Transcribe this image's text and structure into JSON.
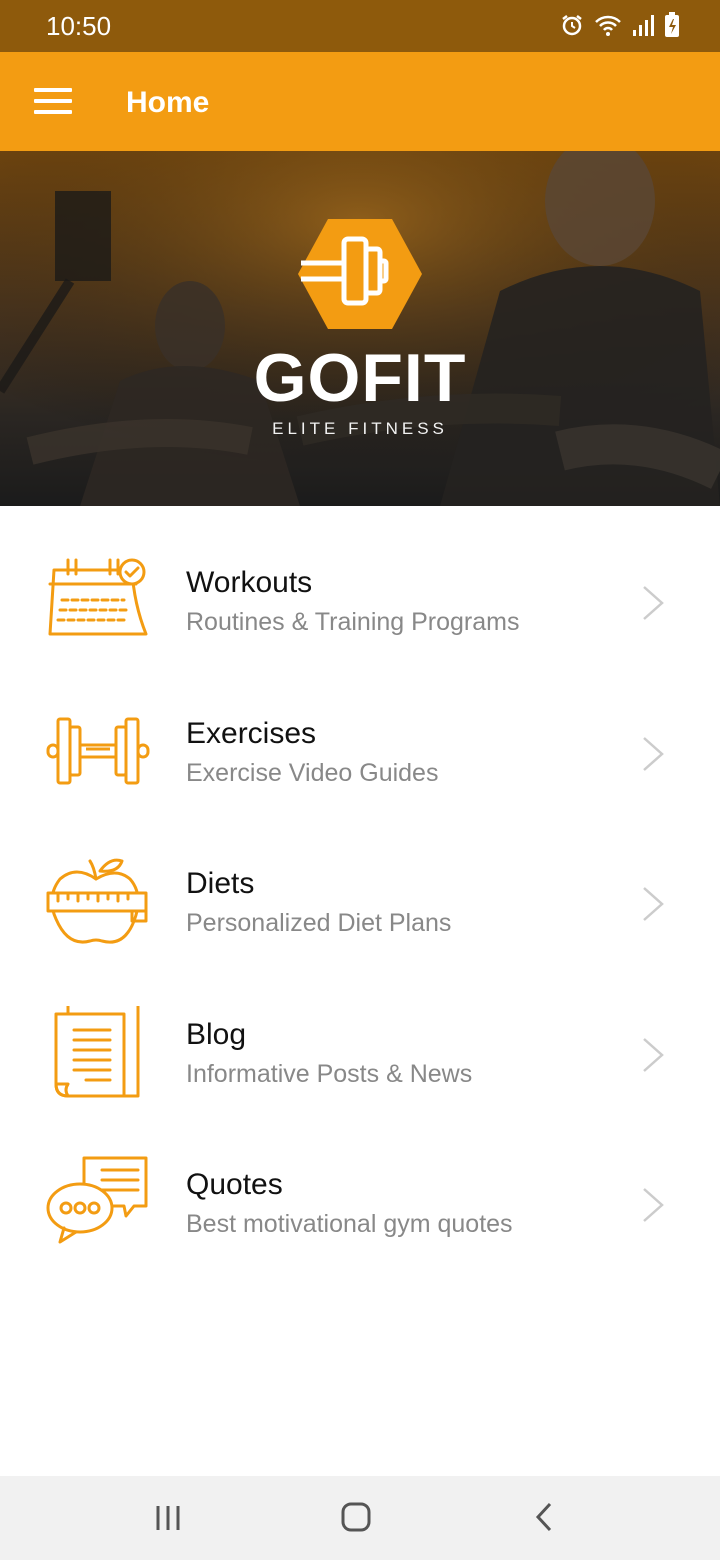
{
  "status_bar": {
    "time": "10:50",
    "icons": [
      "alarm-icon",
      "wifi-icon",
      "signal-icon",
      "battery-charging-icon"
    ]
  },
  "app_bar": {
    "menu_icon": "hamburger-menu-icon",
    "title": "Home"
  },
  "hero": {
    "logo_icon": "dumbbell-hexagon-logo",
    "brand": "GOFIT",
    "tagline": "ELITE FITNESS"
  },
  "menu": {
    "items": [
      {
        "title": "Workouts",
        "subtitle": "Routines & Training Programs",
        "icon": "calendar-check-icon"
      },
      {
        "title": "Exercises",
        "subtitle": "Exercise Video Guides",
        "icon": "dumbbell-icon"
      },
      {
        "title": "Diets",
        "subtitle": "Personalized Diet Plans",
        "icon": "apple-tape-measure-icon"
      },
      {
        "title": "Blog",
        "subtitle": "Informative Posts & News",
        "icon": "document-pages-icon"
      },
      {
        "title": "Quotes",
        "subtitle": "Best motivational gym quotes",
        "icon": "chat-bubbles-icon"
      }
    ]
  },
  "nav_bar": {
    "buttons": [
      "recent-apps-icon",
      "home-icon",
      "back-icon"
    ]
  },
  "colors": {
    "accent": "#f39c12",
    "status_bar": "#8e5a0c",
    "title_text": "#111111",
    "subtitle_text": "#888888",
    "chevron": "#cccccc"
  }
}
